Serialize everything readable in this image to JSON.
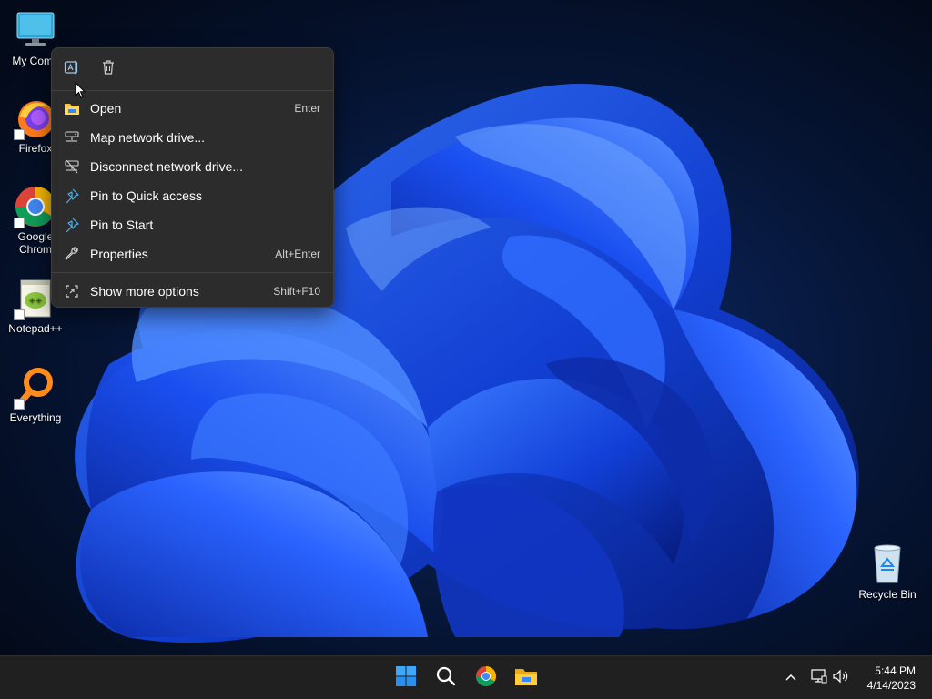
{
  "desktop": {
    "icons": [
      {
        "label": "My Comp",
        "icon": "monitor-icon"
      },
      {
        "label": "Firefox",
        "icon": "firefox-icon"
      },
      {
        "label": "Google Chrom",
        "icon": "chrome-icon"
      },
      {
        "label": "Notepad++",
        "icon": "notepad-plus-plus-icon"
      },
      {
        "label": "Everything",
        "icon": "everything-search-icon"
      },
      {
        "label": "Recycle Bin",
        "icon": "recycle-bin-icon"
      }
    ],
    "chrome_label_line1": "Google",
    "chrome_label_line2": "Chrom"
  },
  "context_menu": {
    "toolbar": [
      {
        "name": "rename",
        "icon": "rename-icon"
      },
      {
        "name": "delete",
        "icon": "trash-icon"
      }
    ],
    "items": [
      {
        "label": "Open",
        "accelerator": "Enter",
        "icon": "folder-open-icon"
      },
      {
        "label": "Map network drive...",
        "accelerator": "",
        "icon": "map-network-drive-icon"
      },
      {
        "label": "Disconnect network drive...",
        "accelerator": "",
        "icon": "disconnect-network-drive-icon"
      },
      {
        "label": "Pin to Quick access",
        "accelerator": "",
        "icon": "pin-icon"
      },
      {
        "label": "Pin to Start",
        "accelerator": "",
        "icon": "pin-icon"
      },
      {
        "label": "Properties",
        "accelerator": "Alt+Enter",
        "icon": "wrench-icon"
      },
      {
        "label": "Show more options",
        "accelerator": "Shift+F10",
        "icon": "show-more-icon"
      }
    ]
  },
  "taskbar": {
    "pinned": [
      {
        "name": "start",
        "icon": "windows-start-icon"
      },
      {
        "name": "search",
        "icon": "search-icon"
      },
      {
        "name": "chrome",
        "icon": "chrome-icon"
      },
      {
        "name": "file-explorer",
        "icon": "folder-icon"
      }
    ],
    "tray": [
      {
        "name": "show-hidden-icons",
        "icon": "chevron-up-icon"
      },
      {
        "name": "network",
        "icon": "network-icon"
      },
      {
        "name": "volume",
        "icon": "speaker-icon"
      }
    ],
    "clock": {
      "time": "5:44 PM",
      "date": "4/14/2023"
    }
  },
  "colors": {
    "menu_bg": "#2c2c2c",
    "taskbar_bg": "#202020",
    "accent_blue": "#1e5bff",
    "wallpaper_dark": "#05112b"
  }
}
